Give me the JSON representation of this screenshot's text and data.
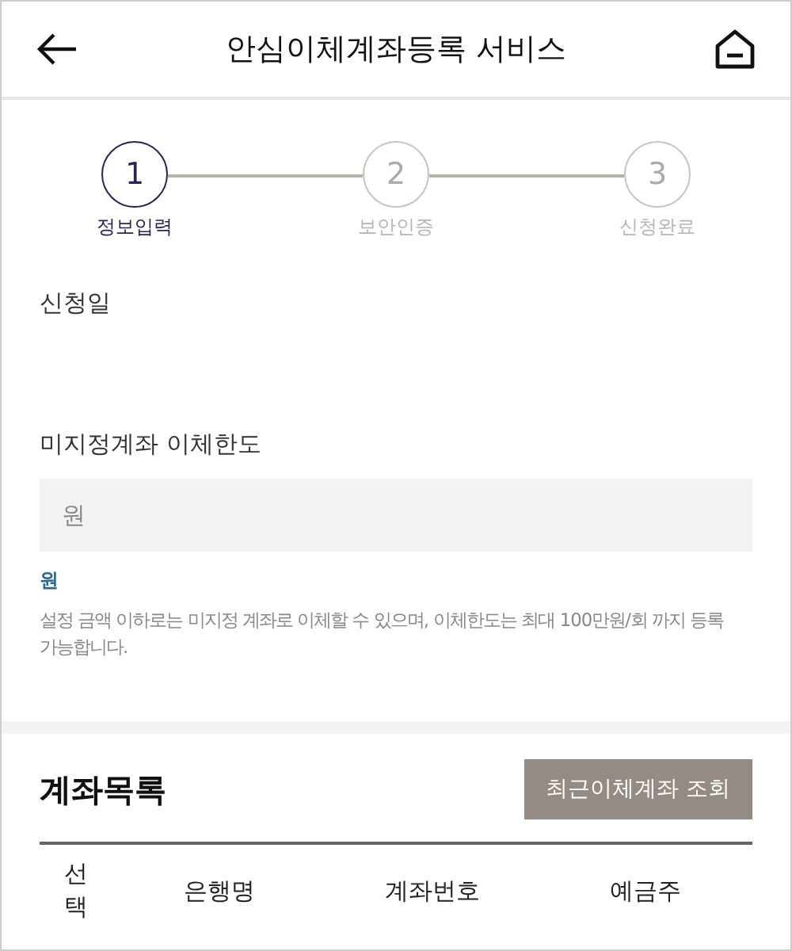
{
  "header": {
    "title": "안심이체계좌등록 서비스"
  },
  "steps": [
    {
      "number": "1",
      "label": "정보입력",
      "selected": true
    },
    {
      "number": "2",
      "label": "보안인증",
      "selected": false
    },
    {
      "number": "3",
      "label": "신청완료",
      "selected": false
    }
  ],
  "form": {
    "date_label": "신청일",
    "limit_label": "미지정계좌 이체한도",
    "limit_field": {
      "placeholder": "원"
    },
    "unit_note": "원",
    "help": "설정 금액 이하로는 미지정 계좌로 이체할 수 있으며, 이체한도는 최대 100만원/회 까지 등록 가능합니다."
  },
  "accounts": {
    "title": "계좌목록",
    "button": "최근이체계좌 조회",
    "columns": [
      "선택",
      "은행명",
      "계좌번호",
      "예금주"
    ]
  }
}
